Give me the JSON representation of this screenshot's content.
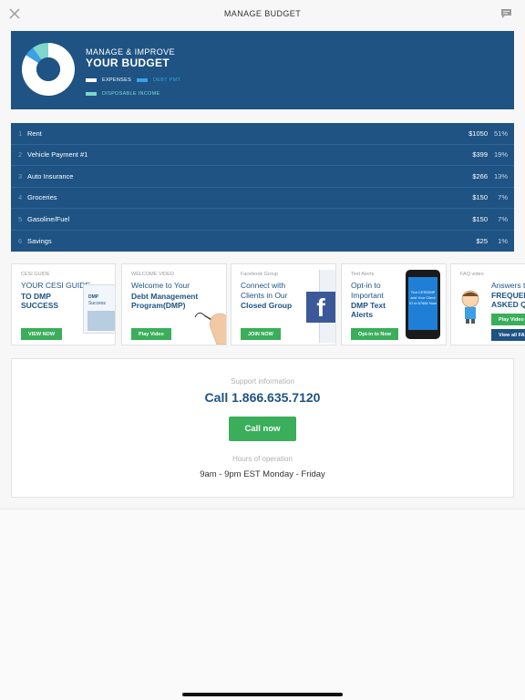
{
  "header": {
    "title": "MANAGE BUDGET",
    "close_icon": "close-icon",
    "chat_icon": "chat-icon"
  },
  "budget": {
    "subtitle": "MANAGE & IMPROVE",
    "title": "YOUR BUDGET",
    "legend": {
      "expenses": "EXPENSES",
      "debt": "DEBT PMT",
      "disposable": "DISPOSABLE INCOME"
    },
    "donut": {
      "expenses": 0.84,
      "debt": 0.06,
      "disposable": 0.1
    },
    "colors": {
      "expenses": "#ffffff",
      "debt": "#3aa0e8",
      "disposable": "#7fd6cc",
      "background": "#1e5384"
    }
  },
  "expenses": [
    {
      "num": "1",
      "name": "Rent",
      "amount": "$1050",
      "pct": "51%"
    },
    {
      "num": "2",
      "name": "Vehicle Payment #1",
      "amount": "$399",
      "pct": "19%"
    },
    {
      "num": "3",
      "name": "Auto Insurance",
      "amount": "$266",
      "pct": "13%"
    },
    {
      "num": "4",
      "name": "Groceries",
      "amount": "$150",
      "pct": "7%"
    },
    {
      "num": "5",
      "name": "Gasoline/Fuel",
      "amount": "$150",
      "pct": "7%"
    },
    {
      "num": "6",
      "name": "Savings",
      "amount": "$25",
      "pct": "1%"
    }
  ],
  "promos": [
    {
      "cat": "CESI GUIDE",
      "line1": "YOUR CESI GUIDE",
      "line2": "TO DMP",
      "line3": "SUCCESS",
      "btn": "VIEW NOW",
      "book_title": "DMP",
      "book_title2": "Success"
    },
    {
      "cat": "WELCOME VIDEO",
      "line1": "Welcome to Your",
      "line2": "Debt Management",
      "line3": "Program(DMP)",
      "btn": "Play Video"
    },
    {
      "cat": "Facebook Group",
      "line1": "Connect with",
      "line2": "Clients in Our",
      "line3": "Closed Group",
      "btn": "JOIN NOW",
      "fb": "f"
    },
    {
      "cat": "Text Alerts",
      "line1": "Opt-in to",
      "line2": "Important",
      "line3": "DMP Text",
      "line4": "Alerts",
      "btn": "Opt-in to Now",
      "phone_text": "Text CESIDMP and Your Client ID to 57682 Now"
    },
    {
      "cat": "FAQ video",
      "line1": "Answers to",
      "line2": "FREQUENTLY",
      "line3": "ASKED QUESTIONS",
      "btn": "Play Video",
      "btn2": "View all FAQs"
    }
  ],
  "support": {
    "label": "Support information",
    "phone": "Call 1.866.635.7120",
    "call_button": "Call now",
    "hours_label": "Hours of operation",
    "hours": "9am - 9pm EST Monday - Friday"
  }
}
